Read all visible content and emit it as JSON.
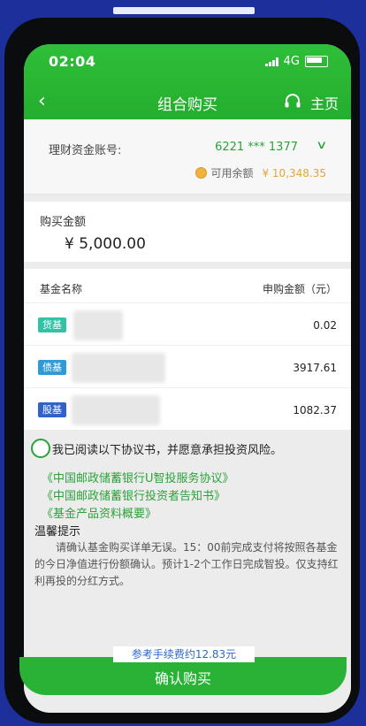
{
  "status": {
    "time": "02:04",
    "network": "4G"
  },
  "nav": {
    "back_icon": "chevron-left-icon",
    "title": "组合购买",
    "service_icon": "headset-icon",
    "home_label": "主页"
  },
  "account": {
    "label": "理财资金账号:",
    "number": "6221 *** 1377",
    "balance_label": "可用余额",
    "balance_value": "¥ 10,348.35"
  },
  "purchase": {
    "label": "购买金额",
    "amount": "¥ 5,000.00"
  },
  "funds": {
    "header_name": "基金名称",
    "header_amount": "申购金额（元）",
    "rows": [
      {
        "badge": "货基",
        "badge_color": "#2fc4a6",
        "amount": "0.02"
      },
      {
        "badge": "债基",
        "badge_color": "#2f9ad8",
        "amount": "3917.61"
      },
      {
        "badge": "股基",
        "badge_color": "#2f63c8",
        "amount": "1082.37"
      }
    ]
  },
  "agreement": {
    "statement": "我已阅读以下协议书，并愿意承担投资风险。",
    "docs": [
      "《中国邮政储蓄银行U智投服务协议》",
      "《中国邮政储蓄银行投资者告知书》",
      "《基金产品资料概要》"
    ],
    "tips_title": "温馨提示",
    "tips_body": "请确认基金购买详单无误。15：00前完成支付将按照各基金的今日净值进行份额确认。预计1-2个工作日完成智投。仅支持红利再投的分红方式。"
  },
  "fee_note": "参考手续费约12.83元",
  "confirm_label": "确认购买",
  "colors": {
    "brand_green": "#2ab236",
    "link_green": "#2aa33a",
    "balance_orange": "#e3a53a",
    "background_blue": "#1d2f9a"
  }
}
